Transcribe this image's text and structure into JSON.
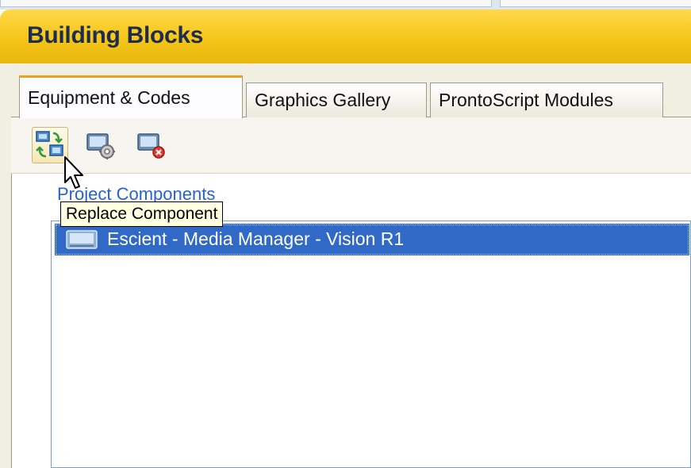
{
  "panel": {
    "title": "Building Blocks"
  },
  "tabs": [
    {
      "label": "Equipment & Codes",
      "active": true
    },
    {
      "label": "Graphics Gallery",
      "active": false
    },
    {
      "label": "ProntoScript Modules",
      "active": false
    }
  ],
  "toolbar": {
    "buttons": [
      {
        "icon": "replace-component-icon",
        "hovered": true
      },
      {
        "icon": "component-settings-icon",
        "hovered": false
      },
      {
        "icon": "delete-component-icon",
        "hovered": false
      }
    ]
  },
  "section": {
    "label": "Project Components"
  },
  "list": {
    "items": [
      {
        "label": "Escient - Media Manager - Vision R1",
        "icon": "device-icon",
        "selected": true
      }
    ]
  },
  "tooltip": {
    "text": "Replace Component"
  },
  "colors": {
    "header": "#f5c518",
    "title_text": "#1e2d4e",
    "selection": "#3169c6",
    "active_tab_accent": "#f0a020",
    "tooltip_bg": "#ffffe1",
    "link": "#2a63c8"
  }
}
